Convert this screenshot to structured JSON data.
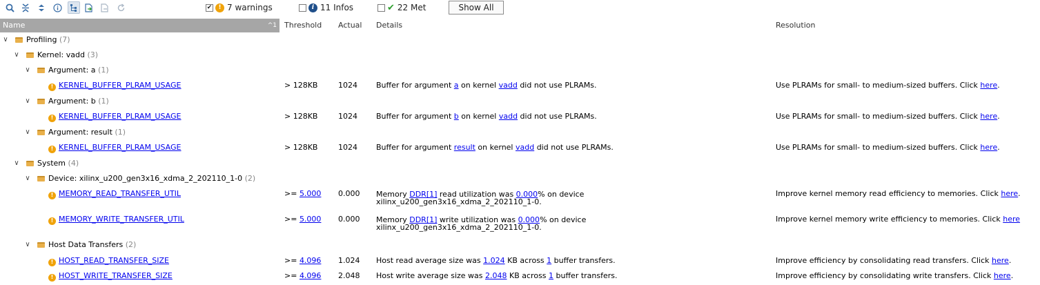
{
  "toolbar": {
    "icons": [
      "search-icon",
      "collapse-all-icon",
      "expand-all-icon",
      "info-icon",
      "tree-view-icon",
      "export-icon",
      "import-icon",
      "refresh-icon"
    ],
    "filters": {
      "warnings": {
        "label": "7 warnings",
        "checked": true
      },
      "infos": {
        "label": "11 Infos",
        "checked": false
      },
      "met": {
        "label": "22 Met",
        "checked": false
      }
    },
    "show_all": "Show All"
  },
  "columns": {
    "name": "Name",
    "sort_indicator": "^1",
    "threshold": "Threshold",
    "actual": "Actual",
    "details": "Details",
    "resolution": "Resolution"
  },
  "tree": {
    "profiling": {
      "label": "Profiling",
      "count": "(7)"
    },
    "kernel": {
      "label": "Kernel: vadd",
      "count": "(3)"
    },
    "arg_a": {
      "label": "Argument: a",
      "count": "(1)"
    },
    "arg_b": {
      "label": "Argument: b",
      "count": "(1)"
    },
    "arg_result": {
      "label": "Argument: result",
      "count": "(1)"
    },
    "system": {
      "label": "System",
      "count": "(4)"
    },
    "device": {
      "label": "Device: xilinx_u200_gen3x16_xdma_2_202110_1-0",
      "count": "(2)"
    },
    "host": {
      "label": "Host Data Transfers",
      "count": "(2)"
    }
  },
  "rules": {
    "a": {
      "name": "KERNEL_BUFFER_PLRAM_USAGE",
      "threshold": "> 128KB",
      "actual": "1024",
      "d1": "Buffer for argument ",
      "d_arg": "a",
      "d2": " on kernel ",
      "d_kernel": "vadd",
      "d3": " did not use PLRAMs.",
      "res": "Use PLRAMs for small- to medium-sized buffers. Click ",
      "res_link": "here",
      "res_end": "."
    },
    "b": {
      "name": "KERNEL_BUFFER_PLRAM_USAGE",
      "threshold": "> 128KB",
      "actual": "1024",
      "d1": "Buffer for argument ",
      "d_arg": "b",
      "d2": " on kernel ",
      "d_kernel": "vadd",
      "d3": " did not use PLRAMs.",
      "res": "Use PLRAMs for small- to medium-sized buffers. Click ",
      "res_link": "here",
      "res_end": "."
    },
    "result": {
      "name": "KERNEL_BUFFER_PLRAM_USAGE",
      "threshold": "> 128KB",
      "actual": "1024",
      "d1": "Buffer for argument ",
      "d_arg": "result",
      "d2": " on kernel ",
      "d_kernel": "vadd",
      "d3": " did not use PLRAMs.",
      "res": "Use PLRAMs for small- to medium-sized buffers. Click ",
      "res_link": "here",
      "res_end": "."
    },
    "mem_read": {
      "name": "MEMORY_READ_TRANSFER_UTIL",
      "threshold_prefix": ">= ",
      "threshold_link": "5.000",
      "actual": "0.000",
      "d1": "Memory ",
      "d_mem": "DDR[1]",
      "d2": " read utilization was ",
      "d_val": "0.000",
      "d3": "% on device",
      "d4": "xilinx_u200_gen3x16_xdma_2_202110_1-0.",
      "res": "Improve kernel memory read efficiency to memories. Click ",
      "res_link": "here",
      "res_end": "."
    },
    "mem_write": {
      "name": "MEMORY_WRITE_TRANSFER_UTIL",
      "threshold_prefix": ">= ",
      "threshold_link": "5.000",
      "actual": "0.000",
      "d1": "Memory ",
      "d_mem": "DDR[1]",
      "d2": " write utilization was ",
      "d_val": "0.000",
      "d3": "% on device",
      "d4": "xilinx_u200_gen3x16_xdma_2_202110_1-0.",
      "res": "Improve kernel memory write efficiency to memories. Click ",
      "res_link": "here",
      "res_end": ""
    },
    "host_read": {
      "name": "HOST_READ_TRANSFER_SIZE",
      "threshold_prefix": ">= ",
      "threshold_link": "4.096",
      "actual": "1.024",
      "d1": "Host read average size was ",
      "d_val": "1.024",
      "d2": " KB across ",
      "d_n": "1",
      "d3": " buffer transfers.",
      "res": "Improve efficiency by consolidating read transfers. Click ",
      "res_link": "here",
      "res_end": "."
    },
    "host_write": {
      "name": "HOST_WRITE_TRANSFER_SIZE",
      "threshold_prefix": ">= ",
      "threshold_link": "4.096",
      "actual": "2.048",
      "d1": "Host write average size was ",
      "d_val": "2.048",
      "d2": " KB across ",
      "d_n": "1",
      "d3": " buffer transfers.",
      "res": "Improve efficiency by consolidating write transfers. Click ",
      "res_link": "here",
      "res_end": "."
    }
  },
  "colors": {
    "warning": "#f0a30a",
    "info": "#1f4f8a",
    "met": "#2e9e2e",
    "link": "#0000ee",
    "header_selected": "#a6a6a6"
  }
}
